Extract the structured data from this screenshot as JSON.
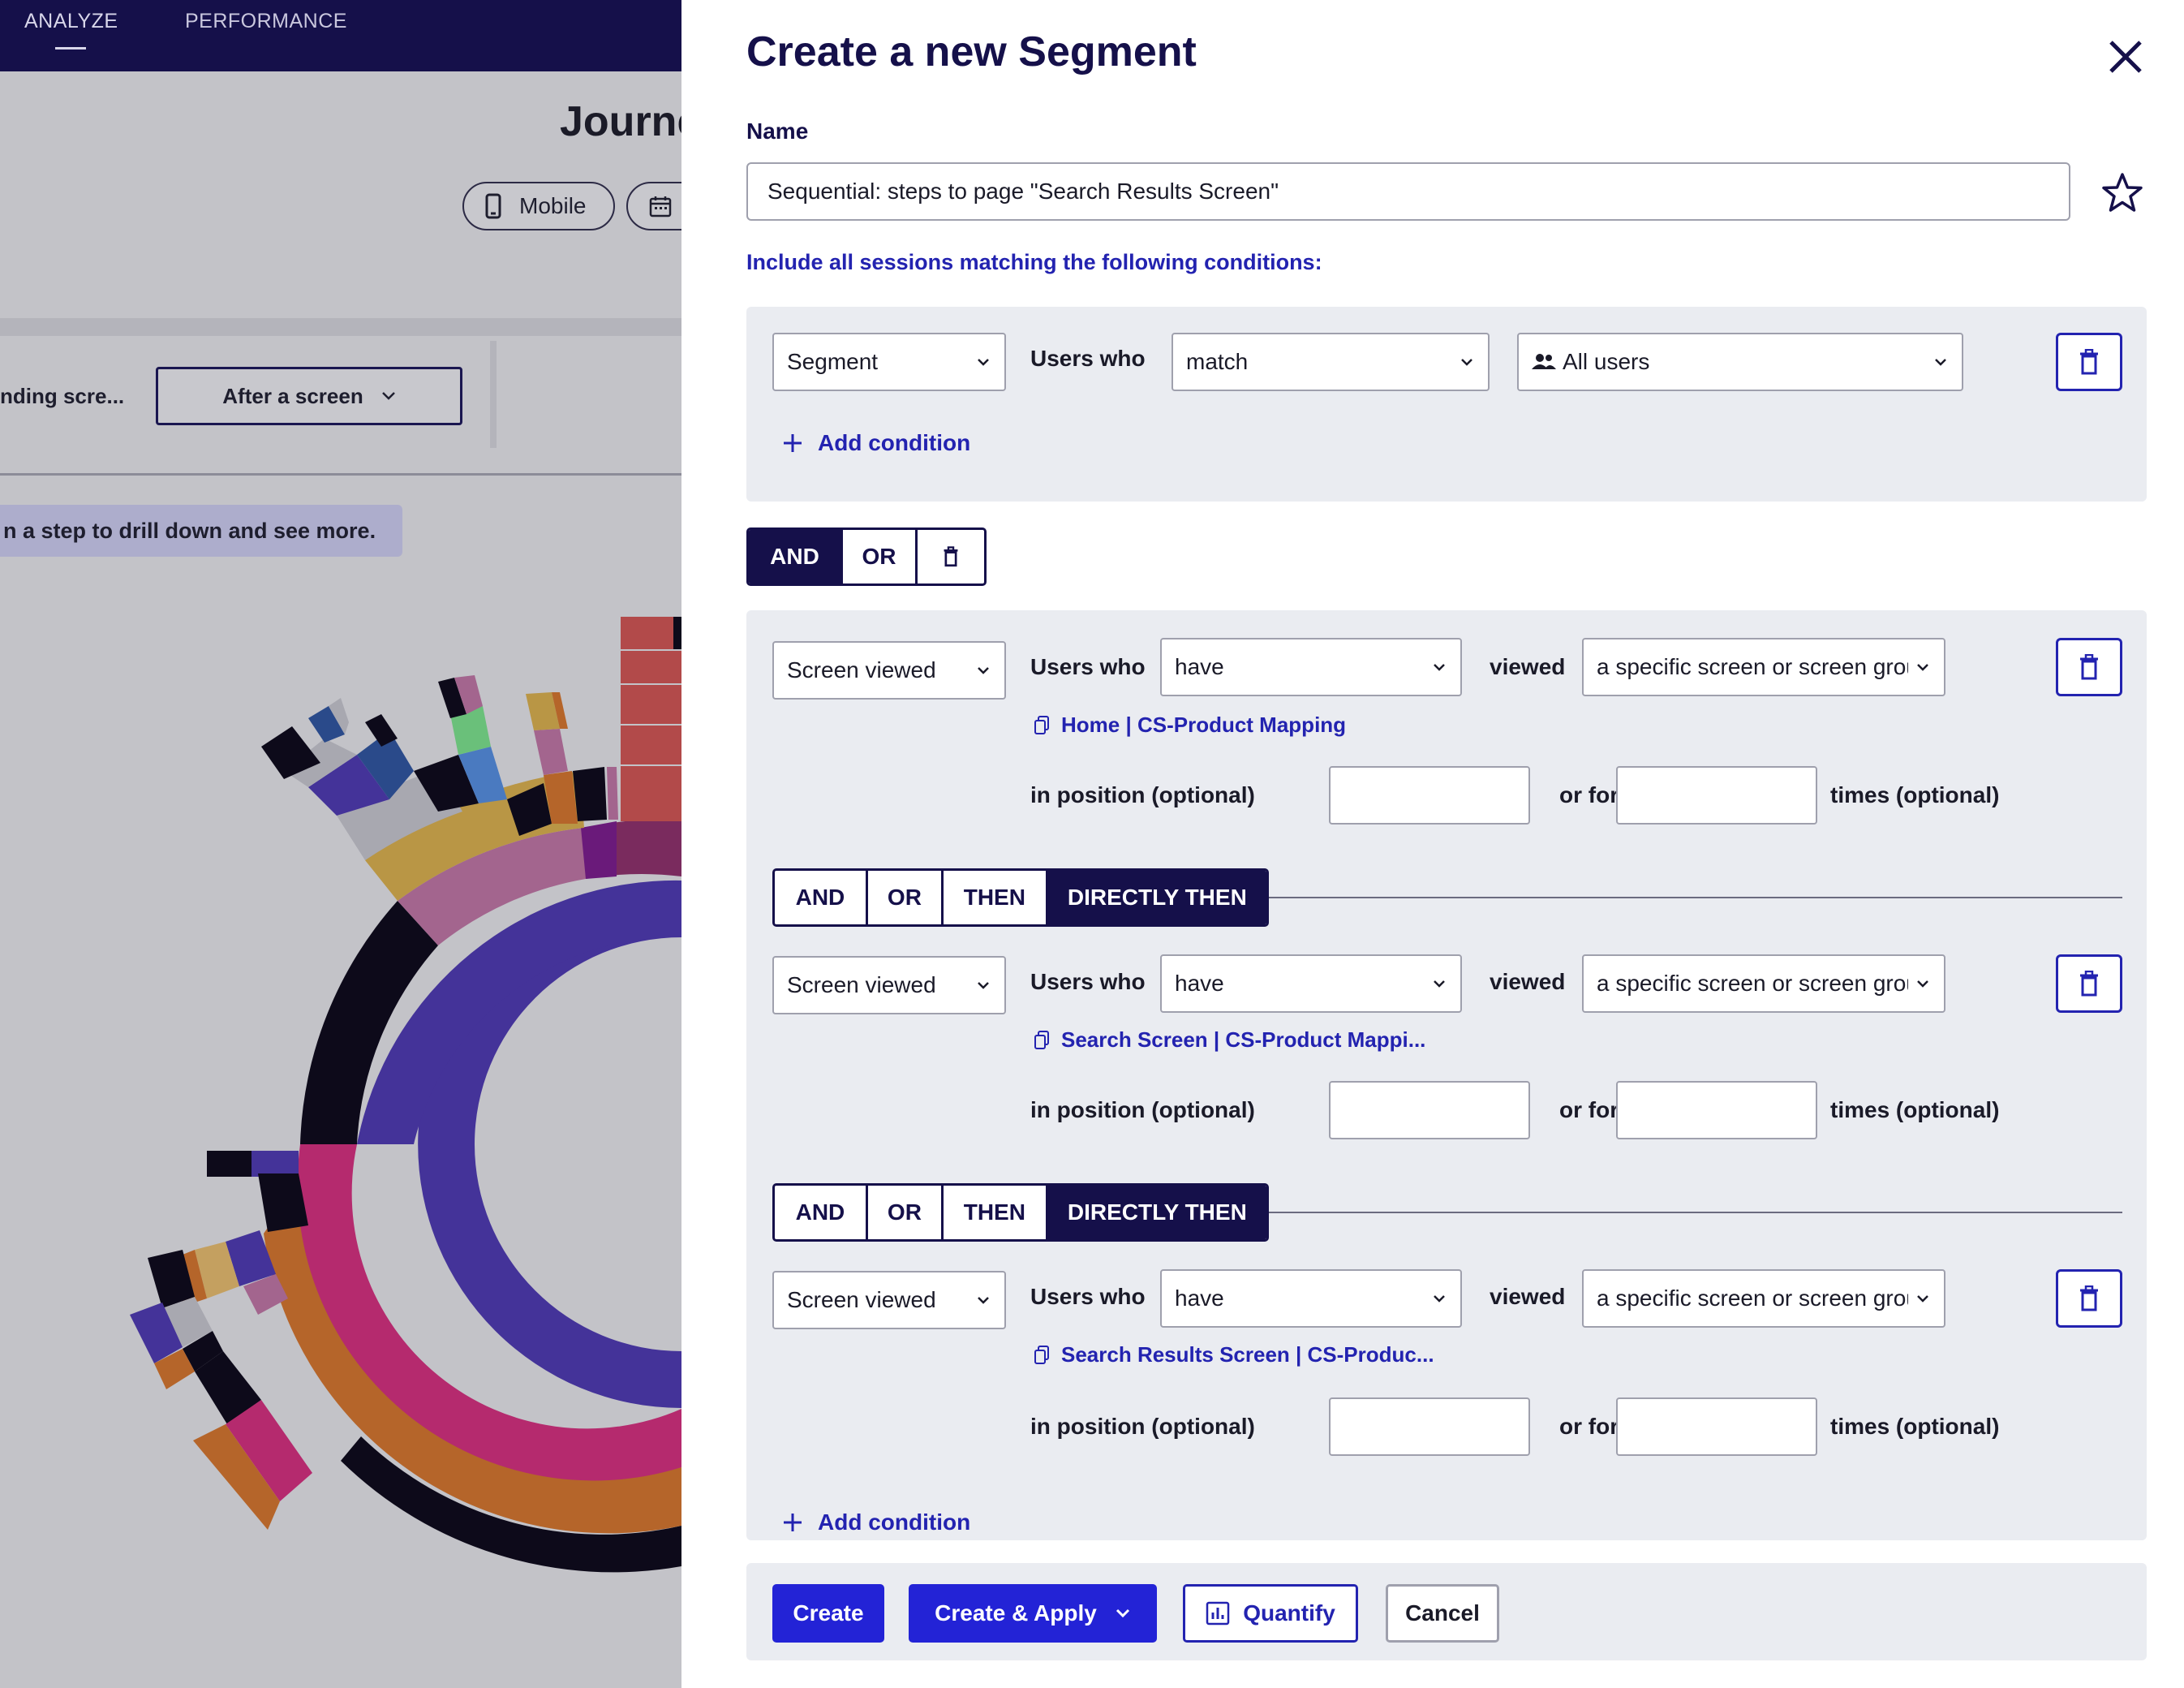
{
  "background": {
    "nav": {
      "analyze": "ANALYZE",
      "performance": "PERFORMANCE"
    },
    "title": "Journe",
    "pills": {
      "mobile": "Mobile"
    },
    "filters": {
      "landing": "nding scre...",
      "after_screen": "After a screen"
    },
    "hint": "n a step to drill down and see more."
  },
  "drawer": {
    "title": "Create a new Segment",
    "name_label": "Name",
    "name_value": "Sequential: steps to page \"Search Results Screen\"",
    "include_label": "Include all sessions matching the following conditions:",
    "segment_block": {
      "type": "Segment",
      "users_who": "Users who",
      "match": "match",
      "audience": "All users",
      "add_condition": "Add condition"
    },
    "group_toggle": {
      "and": "AND",
      "or": "OR"
    },
    "conditions": [
      {
        "type": "Screen viewed",
        "users_who": "Users who",
        "verb": "have",
        "viewed": "viewed",
        "target": "a specific screen or screen group",
        "screen_link": "Home | CS-Product Mapping",
        "position_label": "in position (optional)",
        "or_for": "or for",
        "times_label": "times (optional)"
      },
      {
        "type": "Screen viewed",
        "users_who": "Users who",
        "verb": "have",
        "viewed": "viewed",
        "target": "a specific screen or screen group",
        "screen_link": "Search Screen | CS-Product Mappi...",
        "position_label": "in position (optional)",
        "or_for": "or for",
        "times_label": "times (optional)"
      },
      {
        "type": "Screen viewed",
        "users_who": "Users who",
        "verb": "have",
        "viewed": "viewed",
        "target": "a specific screen or screen group",
        "screen_link": "Search Results Screen | CS-Produc...",
        "position_label": "in position (optional)",
        "or_for": "or for",
        "times_label": "times (optional)"
      }
    ],
    "sequence_toggle": {
      "and": "AND",
      "or": "OR",
      "then": "THEN",
      "directly_then": "DIRECTLY THEN",
      "selected": "DIRECTLY THEN"
    },
    "add_condition": "Add condition",
    "footer": {
      "create": "Create",
      "create_apply": "Create & Apply",
      "quantify": "Quantify",
      "cancel": "Cancel"
    }
  },
  "colors": {
    "navy": "#15104a",
    "accent": "#2323d6",
    "link": "#2323b0",
    "panel": "#eaecf1"
  }
}
